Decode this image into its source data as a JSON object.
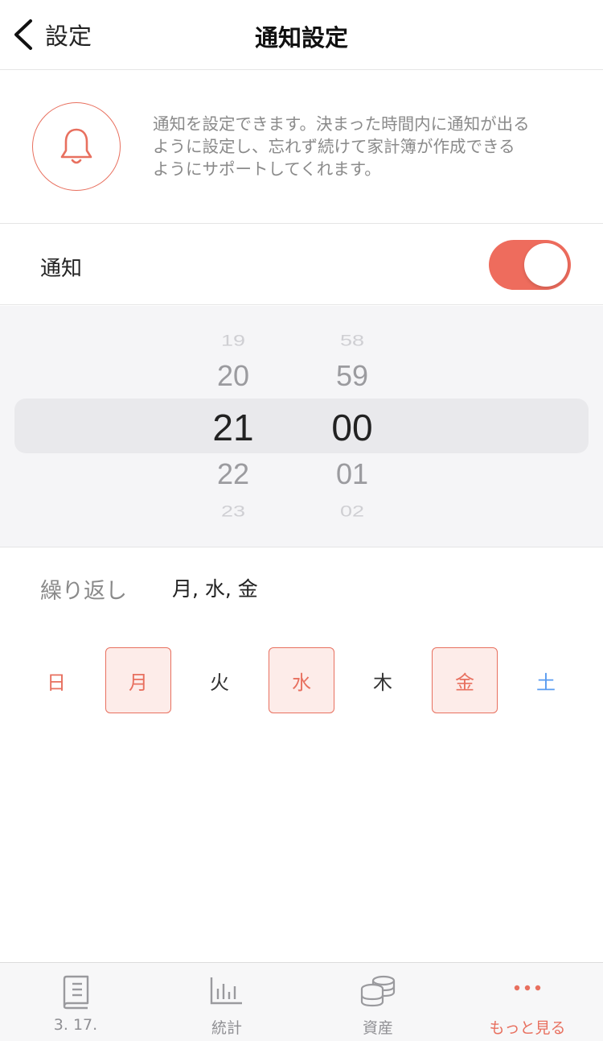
{
  "nav": {
    "back_label": "設定",
    "title": "通知設定"
  },
  "intro": {
    "icon": "bell-icon",
    "text": "通知を設定できます。決まった時間内に通知が出るように設定し、忘れず続けて家計簿が作成できるようにサポートしてくれます。"
  },
  "notification": {
    "label": "通知",
    "enabled": true
  },
  "picker": {
    "hours": [
      "19",
      "20",
      "21",
      "22",
      "23"
    ],
    "minutes": [
      "58",
      "59",
      "00",
      "01",
      "02"
    ]
  },
  "repeat": {
    "label": "繰り返し",
    "value": "月, 水, 金"
  },
  "days": [
    {
      "label": "日",
      "selected": false
    },
    {
      "label": "月",
      "selected": true
    },
    {
      "label": "火",
      "selected": false
    },
    {
      "label": "水",
      "selected": true
    },
    {
      "label": "木",
      "selected": false
    },
    {
      "label": "金",
      "selected": true
    },
    {
      "label": "土",
      "selected": false
    }
  ],
  "tabs": [
    {
      "label": "3. 17.",
      "icon": "book-icon",
      "active": false
    },
    {
      "label": "統計",
      "icon": "bar-chart-icon",
      "active": false
    },
    {
      "label": "資産",
      "icon": "coins-icon",
      "active": false
    },
    {
      "label": "もっと見る",
      "icon": "more-icon",
      "active": true
    }
  ],
  "colors": {
    "accent": "#ee6c5d",
    "accent_light": "#fdece9",
    "saturday": "#5a9cf0"
  }
}
